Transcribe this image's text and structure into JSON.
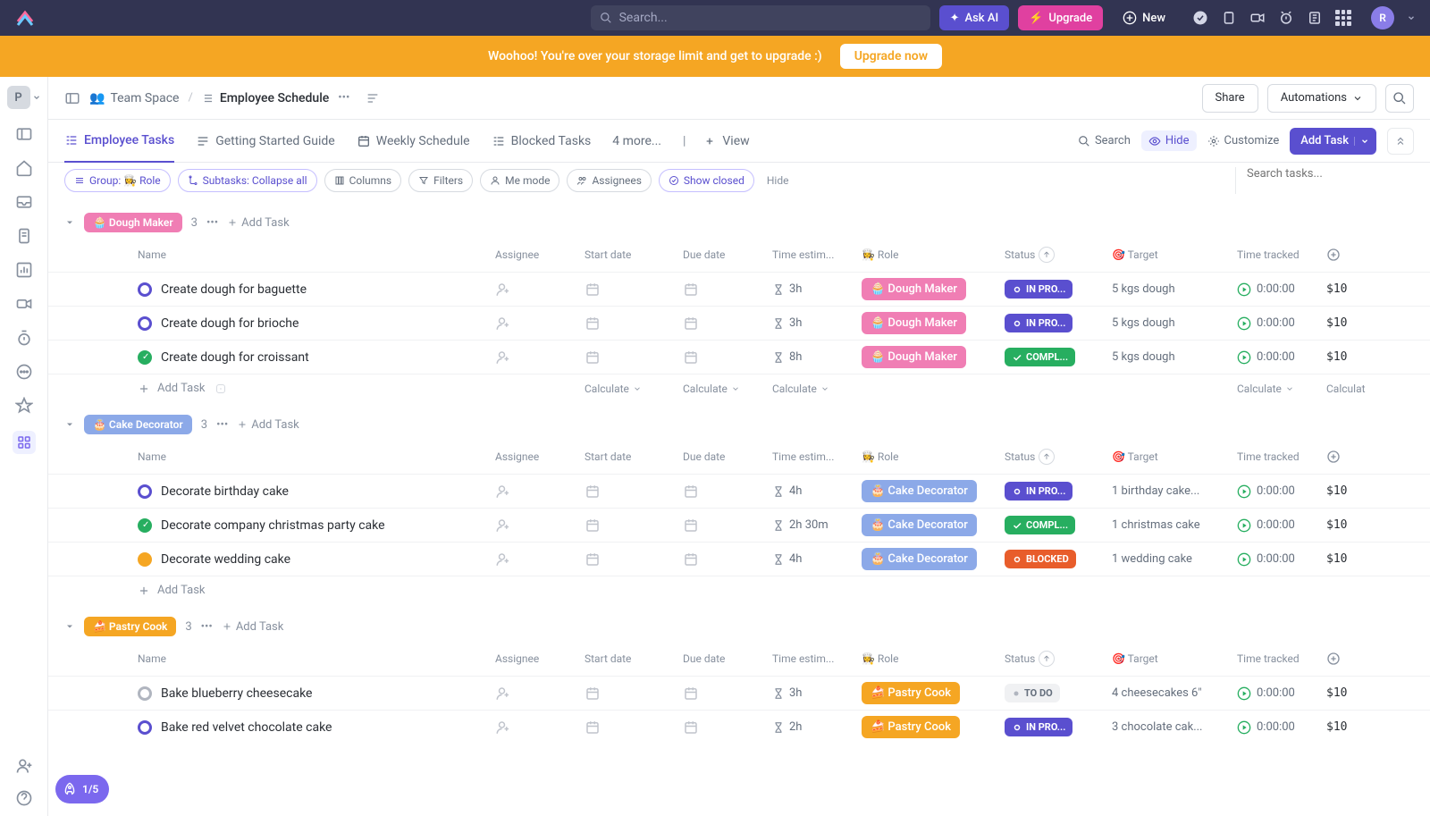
{
  "topbar": {
    "search_placeholder": "Search...",
    "ai_label": "Ask AI",
    "upgrade_label": "Upgrade",
    "new_label": "New",
    "avatar_letter": "R"
  },
  "banner": {
    "text": "Woohoo! You're over your storage limit and get to upgrade :)",
    "button": "Upgrade now"
  },
  "leftrail": {
    "workspace_letter": "P",
    "onboarding": "1/5"
  },
  "breadcrumbs": {
    "folder": "Team Space",
    "folder_icon": "👥",
    "title": "Employee Schedule",
    "share": "Share",
    "automations": "Automations"
  },
  "tabs": {
    "items": [
      "Employee Tasks",
      "Getting Started Guide",
      "Weekly Schedule",
      "Blocked Tasks",
      "4 more...",
      "View"
    ],
    "active_index": 0
  },
  "tabs_right": {
    "search": "Search",
    "hide": "Hide",
    "customize": "Customize",
    "add_task": "Add Task"
  },
  "filters": {
    "group": "Group: 👩‍🍳 Role",
    "subtasks": "Subtasks: Collapse all",
    "columns": "Columns",
    "filters": "Filters",
    "me": "Me mode",
    "assignees": "Assignees",
    "show_closed": "Show closed",
    "hide": "Hide",
    "search_placeholder": "Search tasks..."
  },
  "columns": [
    "Name",
    "Assignee",
    "Start date",
    "Due date",
    "Time estim...",
    "👩‍🍳 Role",
    "Status",
    "🎯 Target",
    "Time tracked",
    ""
  ],
  "add_task_label": "Add Task",
  "calculate_label": "Calculate",
  "groups": [
    {
      "name": "Dough Maker",
      "emoji": "🧁",
      "badge_bg": "#f07eb4",
      "count": 3,
      "tasks": [
        {
          "name": "Create dough for baguette",
          "dot_color": "#5a4fcf",
          "dot_style": "ring",
          "estimate": "3h",
          "role": "Dough Maker",
          "role_bg": "#f07eb4",
          "role_emoji": "🧁",
          "status": "IN PRO...",
          "status_bg": "#5a4fcf",
          "status_icon": "ring",
          "target": "5 kgs dough",
          "tracked": "0:00:00",
          "cost": "$10"
        },
        {
          "name": "Create dough for brioche",
          "dot_color": "#5a4fcf",
          "dot_style": "ring",
          "estimate": "3h",
          "role": "Dough Maker",
          "role_bg": "#f07eb4",
          "role_emoji": "🧁",
          "status": "IN PRO...",
          "status_bg": "#5a4fcf",
          "status_icon": "ring",
          "target": "5 kgs dough",
          "tracked": "0:00:00",
          "cost": "$10"
        },
        {
          "name": "Create dough for croissant",
          "dot_color": "#27ae60",
          "dot_style": "check",
          "estimate": "8h",
          "role": "Dough Maker",
          "role_bg": "#f07eb4",
          "role_emoji": "🧁",
          "status": "COMPL...",
          "status_bg": "#27ae60",
          "status_icon": "check",
          "target": "5 kgs dough",
          "tracked": "0:00:00",
          "cost": "$10"
        }
      ],
      "show_calc": true
    },
    {
      "name": "Cake Decorator",
      "emoji": "🎂",
      "badge_bg": "#8ca9e8",
      "count": 3,
      "tasks": [
        {
          "name": "Decorate birthday cake",
          "dot_color": "#5a4fcf",
          "dot_style": "ring",
          "estimate": "4h",
          "role": "Cake Decorator",
          "role_bg": "#8ca9e8",
          "role_emoji": "🎂",
          "status": "IN PRO...",
          "status_bg": "#5a4fcf",
          "status_icon": "ring",
          "target": "1 birthday cake...",
          "tracked": "0:00:00",
          "cost": "$10"
        },
        {
          "name": "Decorate company christmas party cake",
          "dot_color": "#27ae60",
          "dot_style": "check",
          "estimate": "2h 30m",
          "role": "Cake Decorator",
          "role_bg": "#8ca9e8",
          "role_emoji": "🎂",
          "status": "COMPL...",
          "status_bg": "#27ae60",
          "status_icon": "check",
          "target": "1 christmas cake",
          "tracked": "0:00:00",
          "cost": "$10"
        },
        {
          "name": "Decorate wedding cake",
          "dot_color": "#f5a623",
          "dot_style": "filled",
          "estimate": "4h",
          "role": "Cake Decorator",
          "role_bg": "#8ca9e8",
          "role_emoji": "🎂",
          "status": "BLOCKED",
          "status_bg": "#e85d2b",
          "status_icon": "ring",
          "target": "1 wedding cake",
          "tracked": "0:00:00",
          "cost": "$10"
        }
      ],
      "show_calc": false
    },
    {
      "name": "Pastry Cook",
      "emoji": "🍰",
      "badge_bg": "#f5a623",
      "count": 3,
      "tasks": [
        {
          "name": "Bake blueberry cheesecake",
          "dot_color": "#b0b5bf",
          "dot_style": "ring",
          "estimate": "3h",
          "role": "Pastry Cook",
          "role_bg": "#f5a623",
          "role_emoji": "🍰",
          "status": "TO DO",
          "status_bg": "todo",
          "status_icon": "none",
          "target": "4 cheesecakes 6\"",
          "tracked": "0:00:00",
          "cost": "$10"
        },
        {
          "name": "Bake red velvet chocolate cake",
          "dot_color": "#5a4fcf",
          "dot_style": "ring",
          "estimate": "2h",
          "role": "Pastry Cook",
          "role_bg": "#f5a623",
          "role_emoji": "🍰",
          "status": "IN PRO...",
          "status_bg": "#5a4fcf",
          "status_icon": "ring",
          "target": "3 chocolate cak...",
          "tracked": "0:00:00",
          "cost": "$10"
        }
      ],
      "show_calc": false
    }
  ]
}
